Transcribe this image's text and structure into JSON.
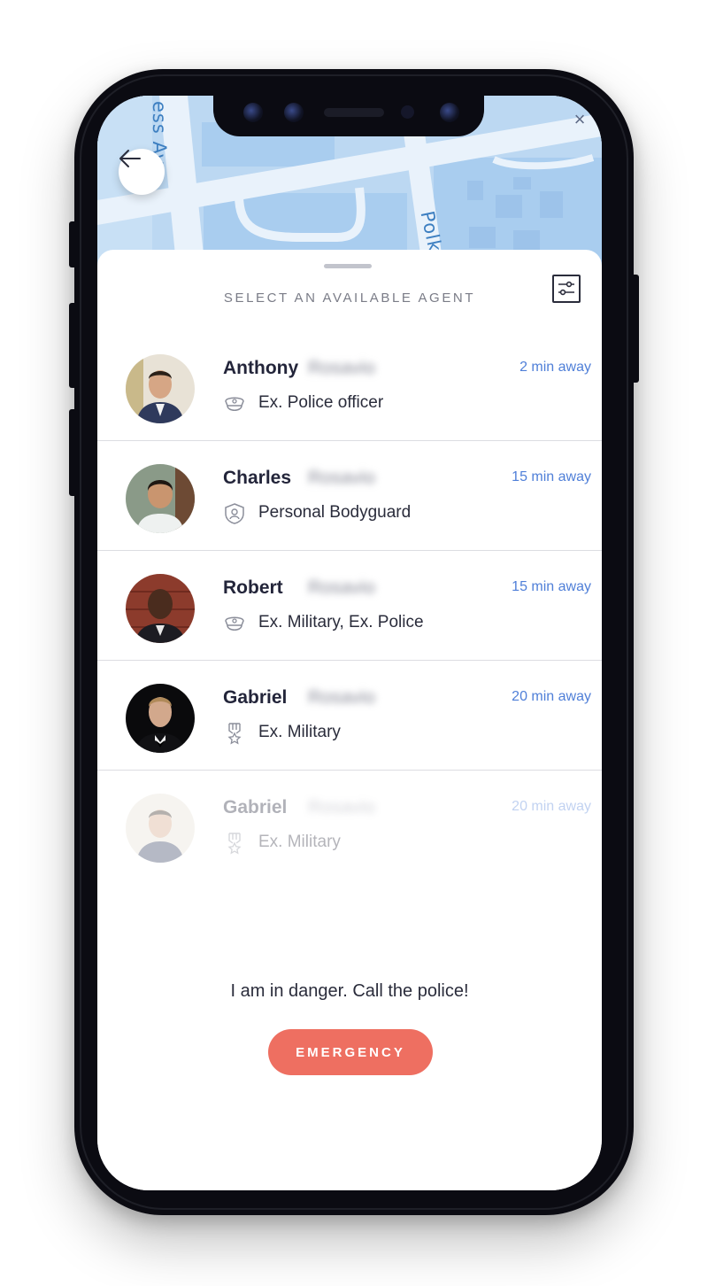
{
  "map": {
    "street_labels": [
      "ess Ave",
      "Polk"
    ]
  },
  "sheet": {
    "title": "SELECT AN AVAILABLE AGENT"
  },
  "agents": [
    {
      "first_name": "Anthony",
      "last_name": "Rosavio",
      "eta": "2 min away",
      "role": "Ex. Police officer",
      "role_icon": "police-cap-icon",
      "avatar": "anthony-avatar",
      "faded": false
    },
    {
      "first_name": "Charles",
      "last_name": "Rosavio",
      "eta": "15 min away",
      "role": "Personal Bodyguard",
      "role_icon": "shield-person-icon",
      "avatar": "charles-avatar",
      "faded": false
    },
    {
      "first_name": "Robert",
      "last_name": "Rosavio",
      "eta": "15 min away",
      "role": "Ex. Military, Ex. Police",
      "role_icon": "police-cap-icon",
      "avatar": "robert-avatar",
      "faded": false
    },
    {
      "first_name": "Gabriel",
      "last_name": "Rosavio",
      "eta": "20 min away",
      "role": "Ex. Military",
      "role_icon": "medal-icon",
      "avatar": "gabriel-avatar",
      "faded": false
    },
    {
      "first_name": "Gabriel",
      "last_name": "Rosavio",
      "eta": "20 min away",
      "role": "Ex. Military",
      "role_icon": "medal-icon",
      "avatar": "gabriel-avatar",
      "faded": true
    }
  ],
  "emergency": {
    "prompt": "I am in danger. Call the police!",
    "button_label": "EMERGENCY"
  },
  "colors": {
    "accent": "#4f7fd8",
    "emergency": "#ee6f61",
    "text": "#23253a",
    "map_water": "#bcd8f2"
  }
}
